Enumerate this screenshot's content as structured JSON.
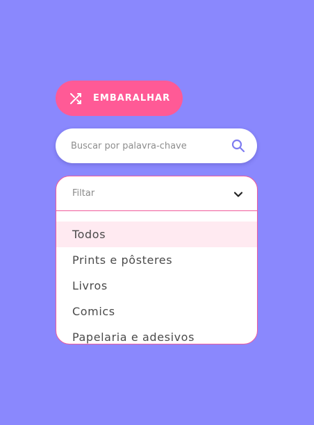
{
  "shuffle_button": {
    "label": "EMBARALHAR",
    "icon": "shuffle-icon"
  },
  "search": {
    "placeholder": "Buscar por palavra-chave",
    "value": "",
    "icon": "search-icon"
  },
  "filter": {
    "label": "Filtar",
    "icon": "chevron-down-icon",
    "selected_index": 0,
    "options": [
      "Todos",
      "Prints e pôsteres",
      "Livros",
      "Comics",
      "Papelaria e adesivos"
    ]
  },
  "colors": {
    "background": "#8a88fd",
    "accent_pink": "#ff5a96",
    "border_pink": "#f05a9b",
    "selected_bg": "#ffeaf1",
    "search_icon": "#7e7cf0"
  }
}
